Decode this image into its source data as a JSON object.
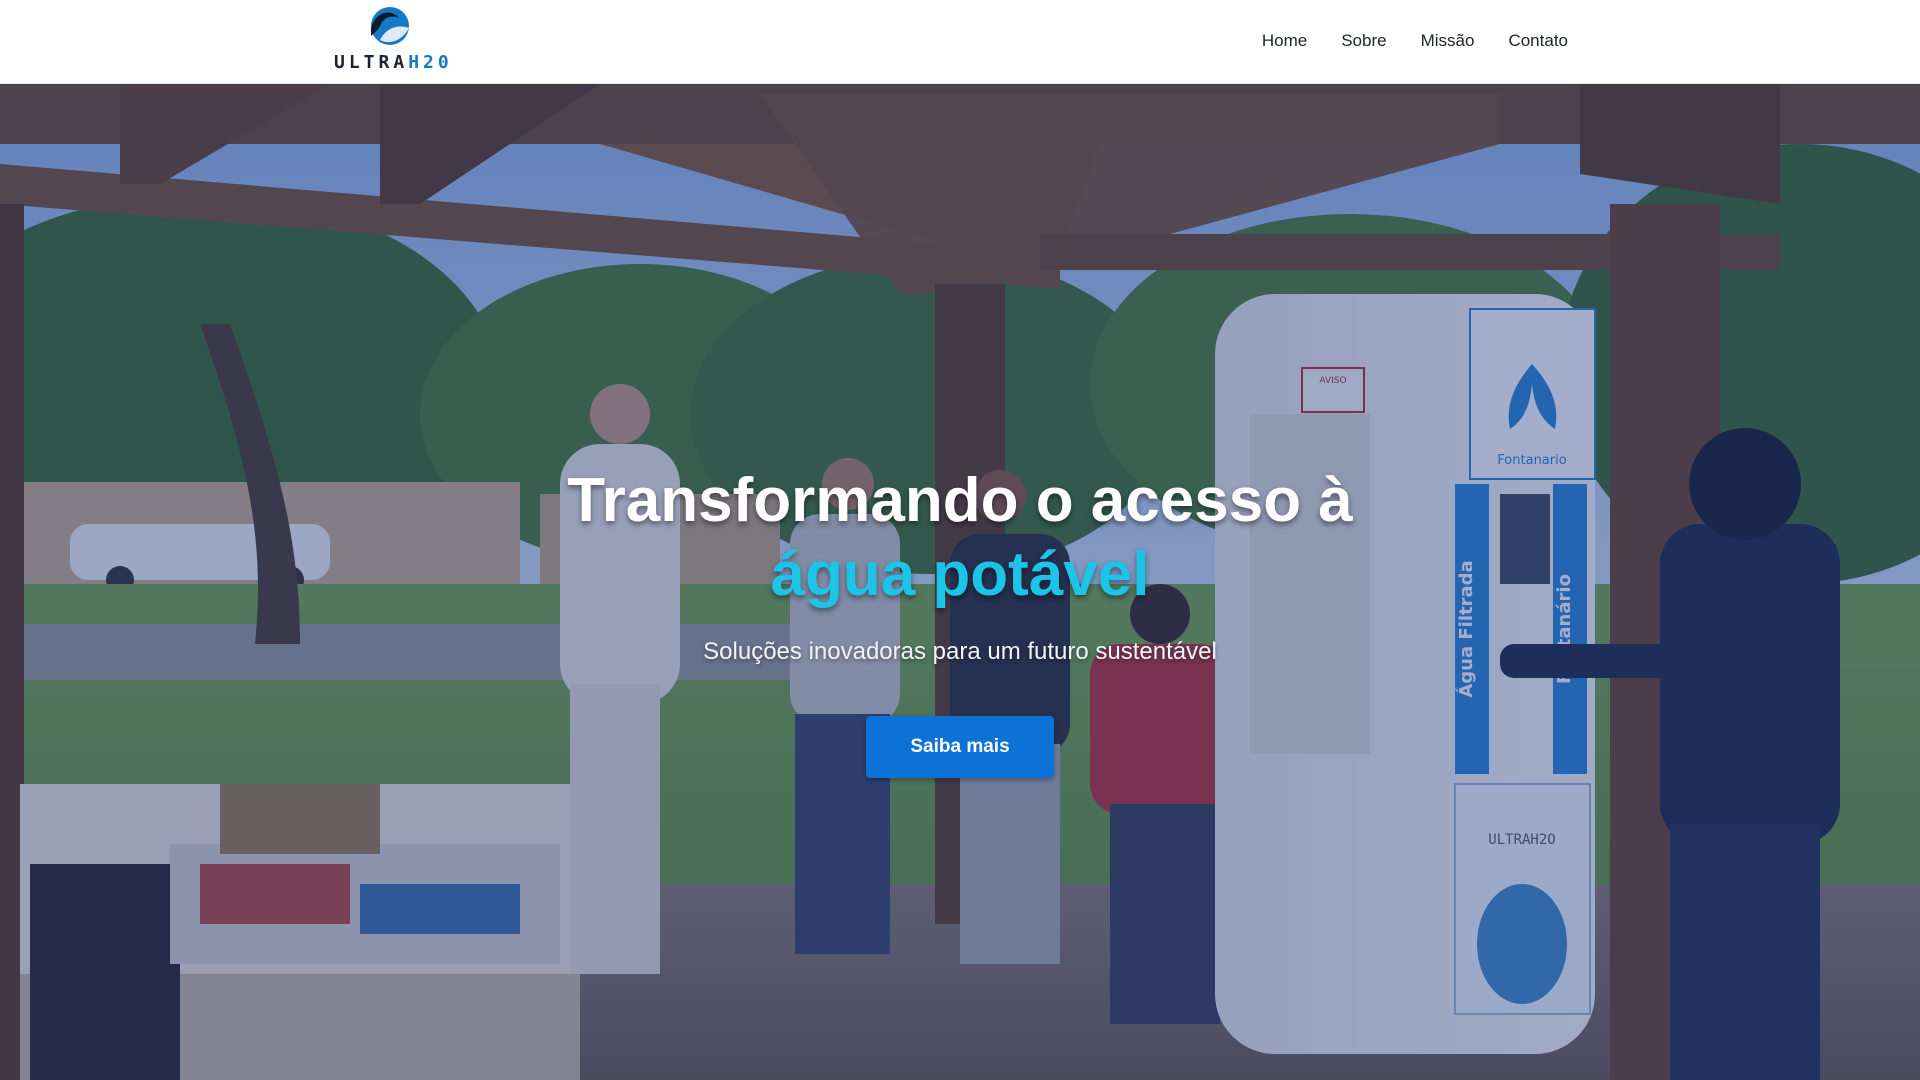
{
  "brand": {
    "logo_part1": "ULTRA",
    "logo_part2": "H20",
    "logo_icon": "water-wave-icon",
    "colors": {
      "primary": "#1479c9",
      "dark": "#1b2430"
    }
  },
  "nav": {
    "items": [
      {
        "label": "Home"
      },
      {
        "label": "Sobre"
      },
      {
        "label": "Missão"
      },
      {
        "label": "Contato"
      }
    ]
  },
  "hero": {
    "title_line1": "Transformando o acesso à",
    "title_line2": "água potável",
    "subtitle": "Soluções inovadoras para um futuro sustentável",
    "cta_label": "Saiba mais",
    "colors": {
      "highlight": "#1cc4e8",
      "button": "#0d72d6"
    },
    "photo": {
      "kiosk_sign": "AVISO",
      "kiosk_brand": "Fontanario",
      "kiosk_side_left": "Água Filtrada",
      "kiosk_side_right": "Fontanário",
      "kiosk_panel": "ULTRAH2O"
    }
  }
}
